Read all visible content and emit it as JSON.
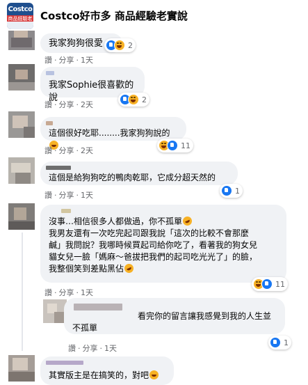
{
  "header": {
    "group_title": "Costco好市多 商品經驗老實說",
    "logo_text": "Costco好市",
    "logo_sub": "商品經驗老實"
  },
  "comments": [
    {
      "id": "c1",
      "text": "我家狗狗很愛",
      "meta": {
        "like": "讚",
        "share": "分享",
        "time": "1天"
      },
      "reactions": {
        "icons": [
          "like",
          "haha"
        ],
        "count": "2"
      }
    },
    {
      "id": "c2",
      "text": "我家Sophie很喜歡的說",
      "meta": {
        "like": "讚",
        "share": "分享",
        "time": "2天"
      },
      "reactions": {
        "icons": [
          "like",
          "haha"
        ],
        "count": "2"
      }
    },
    {
      "id": "c3",
      "text": "這個很好吃耶........我家狗狗說的",
      "meta": {
        "like": "讚",
        "share": "分享",
        "time": "2天"
      },
      "reactions": {
        "icons": [
          "haha",
          "like"
        ],
        "count": "11"
      }
    },
    {
      "id": "c4",
      "text": "這個是給狗狗吃的鴨肉乾耶，它成分超天然的",
      "meta": {
        "like": "讚",
        "share": "分享",
        "time": "1天"
      },
      "reactions": {
        "icons": [
          "like"
        ],
        "count": "1"
      }
    },
    {
      "id": "c5",
      "lines": [
        "沒事…相信很多人都做過，你不孤單",
        "我男友還有一次吃完起司跟我說「這次的比較不會那麼",
        "鹹」我問說？我哪時候買起司給你吃了，看著我的狗女兒",
        "貓女兒一臉「媽麻～爸拔把我們的起司吃光光了」的臉，",
        "我整個笑到差點黑佔"
      ],
      "meta": {
        "like": "讚",
        "share": "分享",
        "time": "1天"
      },
      "reactions": {
        "icons": [
          "haha",
          "like"
        ],
        "count": "11"
      }
    },
    {
      "id": "c6",
      "lines": [
        "看完你的留言讓我感覺到我的人生並",
        "不孤單"
      ],
      "meta": {
        "like": "讚",
        "share": "分享",
        "time": "1天"
      },
      "reactions": {
        "icons": [
          "like"
        ],
        "count": "1"
      }
    },
    {
      "id": "c7",
      "text": "其實版主是在搞笑的，對吧"
    }
  ],
  "colors": {
    "bubble": "#f0f2f5",
    "meta_text": "#65676b",
    "like_blue": "#1877f2",
    "haha_yellow": "#f7b125"
  }
}
